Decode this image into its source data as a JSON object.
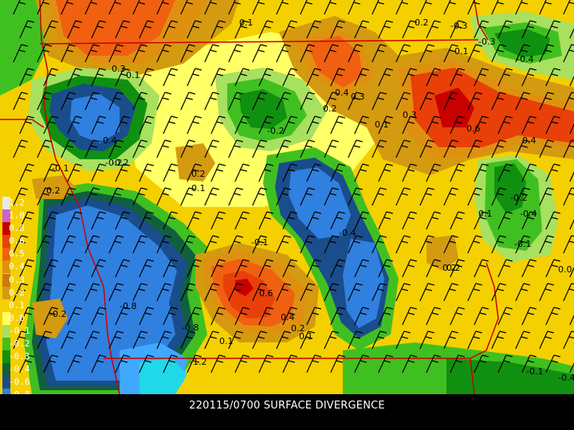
{
  "caption": "220115/0700 SURFACE DIVERGENCE",
  "colors": {
    "div_0_0": "#ffff66",
    "div_0_1": "#f5d000",
    "div_0_2": "#d49a10",
    "div_0_3": "#c87a10",
    "div_0_4": "#e09010",
    "div_0_5": "#f06010",
    "div_0_6": "#e84008",
    "div_0_8": "#c80000",
    "conv_0_1": "#a8e060",
    "conv_0_2": "#40c020",
    "conv_0_3": "#109010",
    "conv_0_4": "#106040",
    "conv_0_6": "#1a4d8c",
    "conv_0_8": "#3080e0",
    "conv_1_2": "#40a8ff",
    "conv_1_6": "#20d8e8",
    "conv_2_0": "#8020c0",
    "state_border": "#cc0000",
    "barb": "#000000"
  },
  "legend": [
    {
      "label": "1.2",
      "color": "#e8e8e8"
    },
    {
      "label": "1.0",
      "color": "#d060d0"
    },
    {
      "label": "0.8",
      "color": "#c80000"
    },
    {
      "label": "0.6",
      "color": "#e84008"
    },
    {
      "label": "0.5",
      "color": "#f06010"
    },
    {
      "label": "0.4",
      "color": "#e09010"
    },
    {
      "label": "0.3",
      "color": "#c87a10"
    },
    {
      "label": "0.2",
      "color": "#d49a10"
    },
    {
      "label": "0.1",
      "color": "#f5d000"
    },
    {
      "label": "0.0",
      "color": "#ffff66"
    },
    {
      "label": "-0.1",
      "color": "#a8e060"
    },
    {
      "label": "-0.2",
      "color": "#40c020"
    },
    {
      "label": "-0.3",
      "color": "#109010"
    },
    {
      "label": "-0.4",
      "color": "#106040"
    },
    {
      "label": "-0.6",
      "color": "#1a4d8c"
    },
    {
      "label": "-0.8",
      "color": "#3080e0"
    },
    {
      "label": "-1.2",
      "color": "#40a8ff"
    },
    {
      "label": "-1.6",
      "color": "#20d8e8"
    },
    {
      "label": "-2.0",
      "color": "#8020c0"
    }
  ],
  "contour_labels": [
    "0.1",
    "0.2",
    "0.1",
    "0.3",
    "0.4",
    "0.3",
    "0.2",
    "0.1",
    "0.3",
    "0.6",
    "0.4",
    "-0.2",
    "-0.4",
    "-0.2",
    "-0.1",
    "0.2",
    "0.1",
    "-0.2",
    "-0.4",
    "-0.3",
    "-0.8",
    "0.6",
    "0.4",
    "0.2",
    "0.1",
    "-0.4",
    "-0.8",
    "-1.2",
    "0.1",
    "0.2",
    "-0.2",
    "-0.1",
    "-0.1",
    "0.1",
    "0.2",
    "-0.3",
    "-0.4",
    "-0.2",
    "0.1",
    "0.2",
    "0.0",
    "-0.1",
    "-0.4"
  ]
}
